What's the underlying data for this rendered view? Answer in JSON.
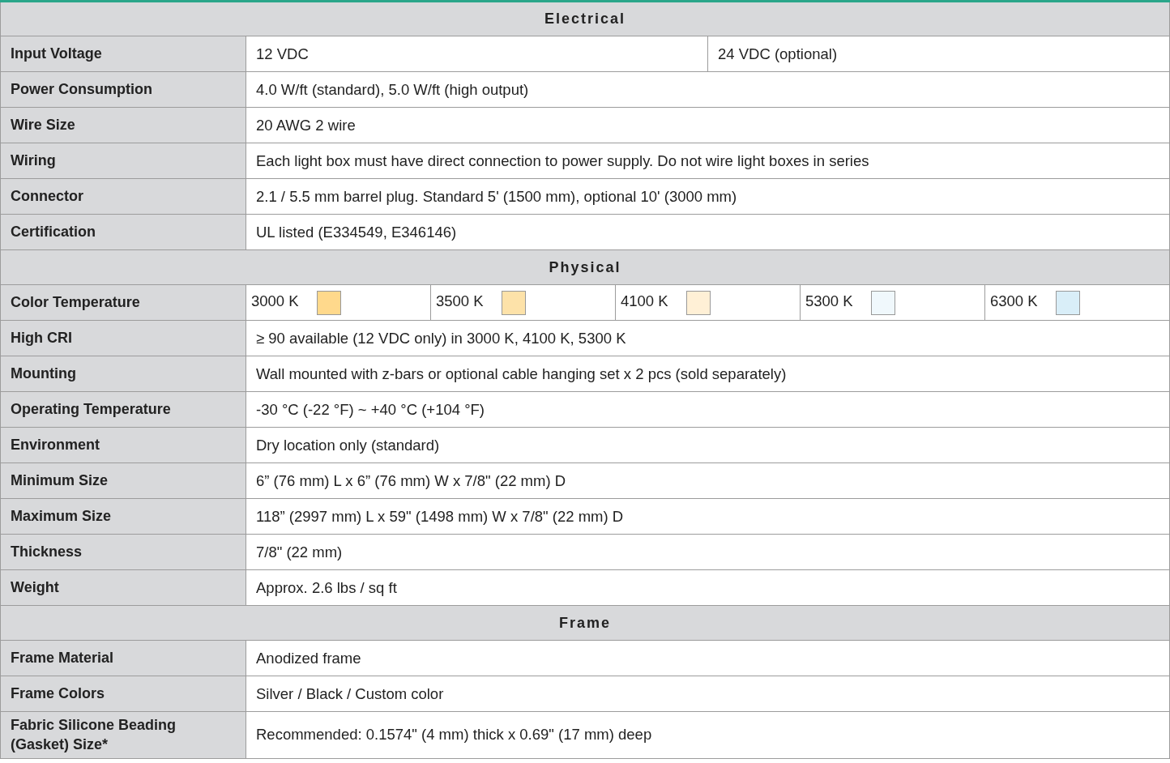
{
  "sections": [
    {
      "title": "Electrical",
      "rows": [
        {
          "label": "Input Voltage",
          "kind": "split",
          "values": [
            "12 VDC",
            "24 VDC (optional)"
          ]
        },
        {
          "label": "Power Consumption",
          "kind": "text",
          "values": [
            "4.0 W/ft (standard), 5.0 W/ft (high output)"
          ]
        },
        {
          "label": "Wire Size",
          "kind": "text",
          "values": [
            "20 AWG 2 wire"
          ]
        },
        {
          "label": "Wiring",
          "kind": "text",
          "values": [
            "Each light box must have direct connection to power supply. Do not wire light boxes in series"
          ]
        },
        {
          "label": "Connector",
          "kind": "text",
          "values": [
            "2.1 / 5.5 mm barrel plug. Standard 5' (1500 mm), optional 10' (3000 mm)"
          ]
        },
        {
          "label": "Certification",
          "kind": "text",
          "values": [
            "UL listed (E334549, E346146)"
          ]
        }
      ]
    },
    {
      "title": "Physical",
      "rows": [
        {
          "label": "Color Temperature",
          "kind": "swatches",
          "swatches": [
            {
              "text": "3000 K",
              "color": "#ffd98c"
            },
            {
              "text": "3500 K",
              "color": "#fde2a9"
            },
            {
              "text": "4100 K",
              "color": "#fff0d6"
            },
            {
              "text": "5300 K",
              "color": "#f0f8fc"
            },
            {
              "text": "6300 K",
              "color": "#d9eef8"
            }
          ]
        },
        {
          "label": "High CRI",
          "kind": "text",
          "values": [
            "≥ 90 available (12 VDC only) in 3000 K, 4100 K, 5300 K"
          ]
        },
        {
          "label": "Mounting",
          "kind": "text",
          "values": [
            "Wall mounted with z-bars or optional cable hanging set x 2 pcs (sold separately)"
          ]
        },
        {
          "label": "Operating Temperature",
          "kind": "text",
          "values": [
            "-30 °C (-22 °F) ~ +40 °C (+104 °F)"
          ]
        },
        {
          "label": "Environment",
          "kind": "text",
          "values": [
            "Dry location only (standard)"
          ]
        },
        {
          "label": "Minimum Size",
          "kind": "text",
          "values": [
            "6” (76 mm) L x 6” (76 mm) W x 7/8\" (22 mm) D"
          ]
        },
        {
          "label": "Maximum Size",
          "kind": "text",
          "values": [
            "118” (2997 mm) L x 59\" (1498 mm) W x 7/8\" (22 mm) D"
          ]
        },
        {
          "label": "Thickness",
          "kind": "text",
          "values": [
            "7/8\" (22 mm)"
          ]
        },
        {
          "label": "Weight",
          "kind": "text",
          "values": [
            "Approx. 2.6 lbs / sq ft"
          ]
        }
      ]
    },
    {
      "title": "Frame",
      "rows": [
        {
          "label": "Frame Material",
          "kind": "text",
          "values": [
            "Anodized frame"
          ]
        },
        {
          "label": "Frame Colors",
          "kind": "text",
          "values": [
            "Silver / Black / Custom color"
          ]
        },
        {
          "label": "Fabric Silicone Beading (Gasket) Size*",
          "kind": "text",
          "values": [
            "Recommended: 0.1574\" (4 mm) thick x 0.69\" (17 mm) deep"
          ]
        }
      ]
    }
  ]
}
